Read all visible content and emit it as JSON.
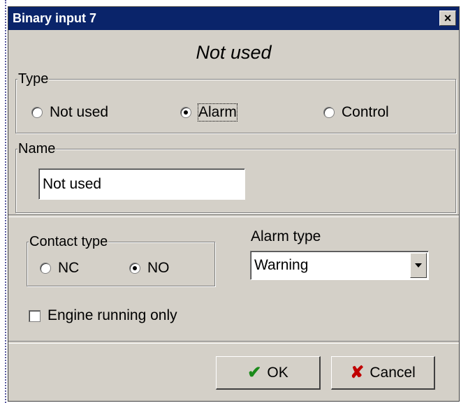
{
  "window": {
    "title": "Binary input 7",
    "close_glyph": "×"
  },
  "header": {
    "subtitle": "Not used"
  },
  "type_group": {
    "legend": "Type",
    "options": [
      {
        "label": "Not used",
        "selected": false
      },
      {
        "label": "Alarm",
        "selected": true
      },
      {
        "label": "Control",
        "selected": false
      }
    ]
  },
  "name_group": {
    "legend": "Name",
    "value": "Not used"
  },
  "contact_group": {
    "legend": "Contact type",
    "options": [
      {
        "label": "NC",
        "selected": false
      },
      {
        "label": "NO",
        "selected": true
      }
    ]
  },
  "alarm_type": {
    "label": "Alarm type",
    "value": "Warning"
  },
  "engine_running": {
    "label": "Engine running only",
    "checked": false
  },
  "buttons": {
    "ok": {
      "label": "OK",
      "icon": "check-icon",
      "color": "#1a8a1a"
    },
    "cancel": {
      "label": "Cancel",
      "icon": "x-icon",
      "color": "#c00000"
    }
  },
  "colors": {
    "titlebar": "#0a246a",
    "dialog_bg": "#d4d0c8"
  }
}
